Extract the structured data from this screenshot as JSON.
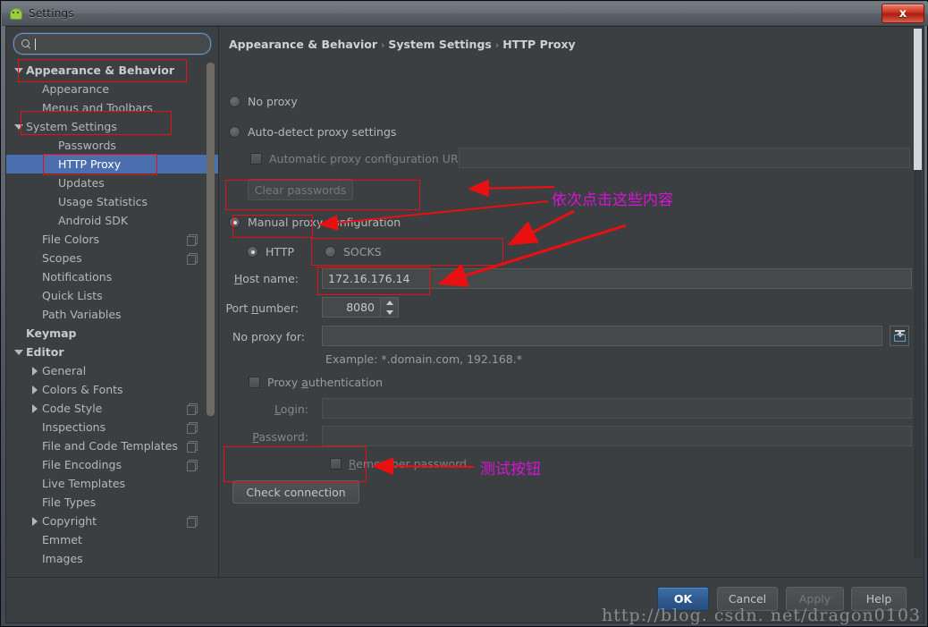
{
  "window": {
    "title": "Settings",
    "app_icon": "android-studio-icon",
    "close_label": "x"
  },
  "search": {
    "value": "",
    "placeholder": "",
    "icon": "search-icon"
  },
  "sidebar": {
    "items": [
      {
        "label": "Appearance & Behavior",
        "indent": 0,
        "arrow": "down",
        "bold": true,
        "selected": false,
        "badge": false
      },
      {
        "label": "Appearance",
        "indent": 1,
        "arrow": "none",
        "bold": false,
        "selected": false,
        "badge": false
      },
      {
        "label": "Menus and Toolbars",
        "indent": 1,
        "arrow": "none",
        "bold": false,
        "selected": false,
        "badge": false
      },
      {
        "label": "System Settings",
        "indent": 0,
        "arrow": "down",
        "bold": false,
        "selected": false,
        "badge": false
      },
      {
        "label": "Passwords",
        "indent": 2,
        "arrow": "none",
        "bold": false,
        "selected": false,
        "badge": false
      },
      {
        "label": "HTTP Proxy",
        "indent": 2,
        "arrow": "none",
        "bold": false,
        "selected": true,
        "badge": false
      },
      {
        "label": "Updates",
        "indent": 2,
        "arrow": "none",
        "bold": false,
        "selected": false,
        "badge": false
      },
      {
        "label": "Usage Statistics",
        "indent": 2,
        "arrow": "none",
        "bold": false,
        "selected": false,
        "badge": false
      },
      {
        "label": "Android SDK",
        "indent": 2,
        "arrow": "none",
        "bold": false,
        "selected": false,
        "badge": false
      },
      {
        "label": "File Colors",
        "indent": 1,
        "arrow": "none",
        "bold": false,
        "selected": false,
        "badge": true
      },
      {
        "label": "Scopes",
        "indent": 1,
        "arrow": "none",
        "bold": false,
        "selected": false,
        "badge": true
      },
      {
        "label": "Notifications",
        "indent": 1,
        "arrow": "none",
        "bold": false,
        "selected": false,
        "badge": false
      },
      {
        "label": "Quick Lists",
        "indent": 1,
        "arrow": "none",
        "bold": false,
        "selected": false,
        "badge": false
      },
      {
        "label": "Path Variables",
        "indent": 1,
        "arrow": "none",
        "bold": false,
        "selected": false,
        "badge": false
      },
      {
        "label": "Keymap",
        "indent": 0,
        "arrow": "none",
        "bold": true,
        "selected": false,
        "badge": false
      },
      {
        "label": "Editor",
        "indent": 0,
        "arrow": "down",
        "bold": true,
        "selected": false,
        "badge": false
      },
      {
        "label": "General",
        "indent": 1,
        "arrow": "right",
        "bold": false,
        "selected": false,
        "badge": false
      },
      {
        "label": "Colors & Fonts",
        "indent": 1,
        "arrow": "right",
        "bold": false,
        "selected": false,
        "badge": false
      },
      {
        "label": "Code Style",
        "indent": 1,
        "arrow": "right",
        "bold": false,
        "selected": false,
        "badge": true
      },
      {
        "label": "Inspections",
        "indent": 1,
        "arrow": "none",
        "bold": false,
        "selected": false,
        "badge": true
      },
      {
        "label": "File and Code Templates",
        "indent": 1,
        "arrow": "none",
        "bold": false,
        "selected": false,
        "badge": true
      },
      {
        "label": "File Encodings",
        "indent": 1,
        "arrow": "none",
        "bold": false,
        "selected": false,
        "badge": true
      },
      {
        "label": "Live Templates",
        "indent": 1,
        "arrow": "none",
        "bold": false,
        "selected": false,
        "badge": false
      },
      {
        "label": "File Types",
        "indent": 1,
        "arrow": "none",
        "bold": false,
        "selected": false,
        "badge": false
      },
      {
        "label": "Copyright",
        "indent": 1,
        "arrow": "right",
        "bold": false,
        "selected": false,
        "badge": true
      },
      {
        "label": "Emmet",
        "indent": 1,
        "arrow": "none",
        "bold": false,
        "selected": false,
        "badge": false
      },
      {
        "label": "Images",
        "indent": 1,
        "arrow": "none",
        "bold": false,
        "selected": false,
        "badge": false
      }
    ]
  },
  "breadcrumb": {
    "part1": "Appearance & Behavior",
    "part2": "System Settings",
    "part3": "HTTP Proxy",
    "separator": "›"
  },
  "proxy": {
    "no_proxy_label": "No proxy",
    "auto_detect_label": "Auto-detect proxy settings",
    "auto_url_label": "Automatic proxy configuration URL:",
    "auto_url_value": "",
    "clear_passwords_label": "Clear passwords",
    "manual_label": "Manual proxy configuration",
    "http_label": "HTTP",
    "socks_label": "SOCKS",
    "host_name_label": "Host name:",
    "host_name_value": "172.16.176.14",
    "port_number_label": "Port number:",
    "port_number_value": "8080",
    "no_proxy_for_label": "No proxy for:",
    "no_proxy_for_value": "",
    "example_text": "Example: *.domain.com, 192.168.*",
    "proxy_auth_label": "Proxy authentication",
    "login_label": "Login:",
    "login_value": "",
    "password_label": "Password:",
    "password_value": "",
    "remember_password_label": "Remember password",
    "check_connection_label": "Check connection",
    "expand_icon": "insert-into-field-icon",
    "selected_mode": "manual",
    "selected_protocol": "HTTP"
  },
  "footer": {
    "ok_label": "OK",
    "cancel_label": "Cancel",
    "apply_label": "Apply",
    "help_label": "Help"
  },
  "watermark": {
    "text": "http://blog. csdn. net/dragon0103"
  },
  "annotations": {
    "note1": "依次点击这些内容",
    "note2": "测试按钮",
    "box_color": "#e81010",
    "text_color": "#d812d8"
  }
}
